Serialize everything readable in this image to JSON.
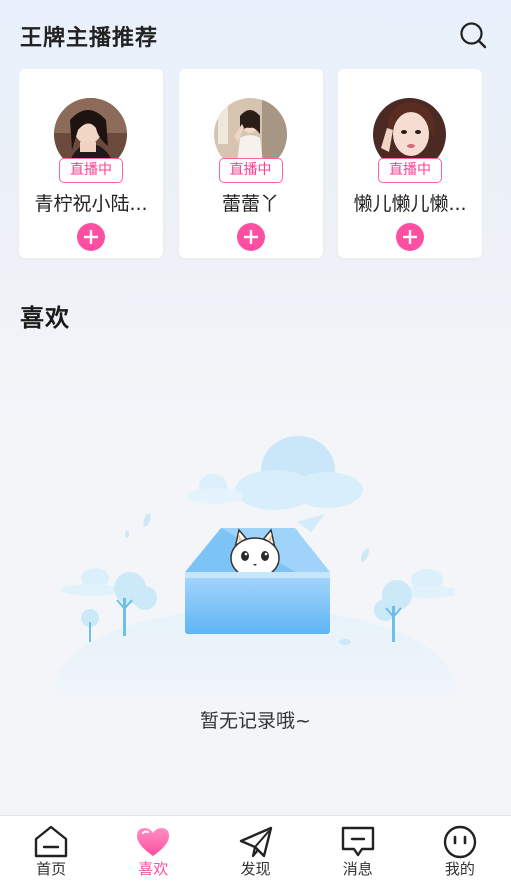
{
  "header": {
    "title": "王牌主播推荐",
    "search_icon": "search-icon"
  },
  "anchors": [
    {
      "name": "青柠祝小陆...",
      "badge": "直播中",
      "avatar_bg": "#5b3a2e"
    },
    {
      "name": "蕾蕾丫",
      "badge": "直播中",
      "avatar_bg": "#d9c6b2"
    },
    {
      "name": "懒儿懒儿懒...",
      "badge": "直播中",
      "avatar_bg": "#8a5a48"
    }
  ],
  "favorites": {
    "title": "喜欢",
    "empty_text": "暂无记录哦~"
  },
  "tabbar": {
    "items": [
      {
        "label": "首页",
        "icon": "home-icon"
      },
      {
        "label": "喜欢",
        "icon": "heart-icon"
      },
      {
        "label": "发现",
        "icon": "paper-plane-icon"
      },
      {
        "label": "消息",
        "icon": "message-icon"
      },
      {
        "label": "我的",
        "icon": "face-icon"
      }
    ],
    "active_index": 1
  },
  "colors": {
    "accent": "#ff4fa1",
    "badge_border": "#ff5fa6"
  }
}
